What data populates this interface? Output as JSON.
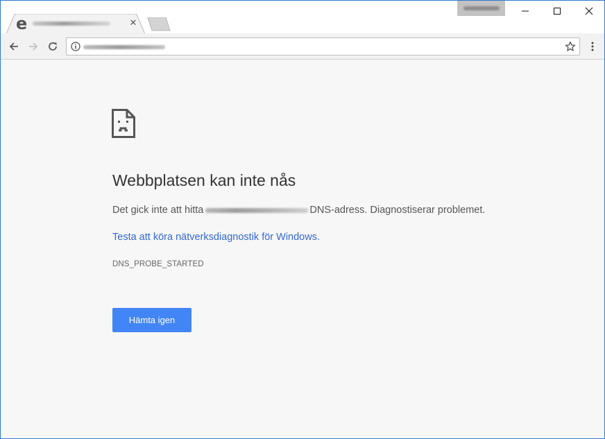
{
  "tab": {
    "favicon": "e",
    "title": "",
    "close_symbol": "✕",
    "icon_name": "edge-e-icon"
  },
  "window_controls": {
    "minimize": "—",
    "maximize": "☐",
    "close": "✕"
  },
  "toolbar": {
    "url": "",
    "icons": [
      "back-arrow-icon",
      "forward-arrow-icon",
      "reload-icon",
      "info-icon",
      "star-icon",
      "more-vert-icon"
    ]
  },
  "page": {
    "heading": "Webbplatsen kan inte nås",
    "desc_prefix": "Det gick inte att hitta",
    "desc_suffix": "DNS-adress. Diagnostiserar problemet.",
    "link": "Testa att köra nätverksdiagnostik för Windows.",
    "error_code": "DNS_PROBE_STARTED",
    "button": "Hämta igen"
  },
  "colors": {
    "accent_button": "#4285f4",
    "link": "#3367d6",
    "page_bg": "#f7f7f7",
    "window_border": "#2b79d0"
  }
}
